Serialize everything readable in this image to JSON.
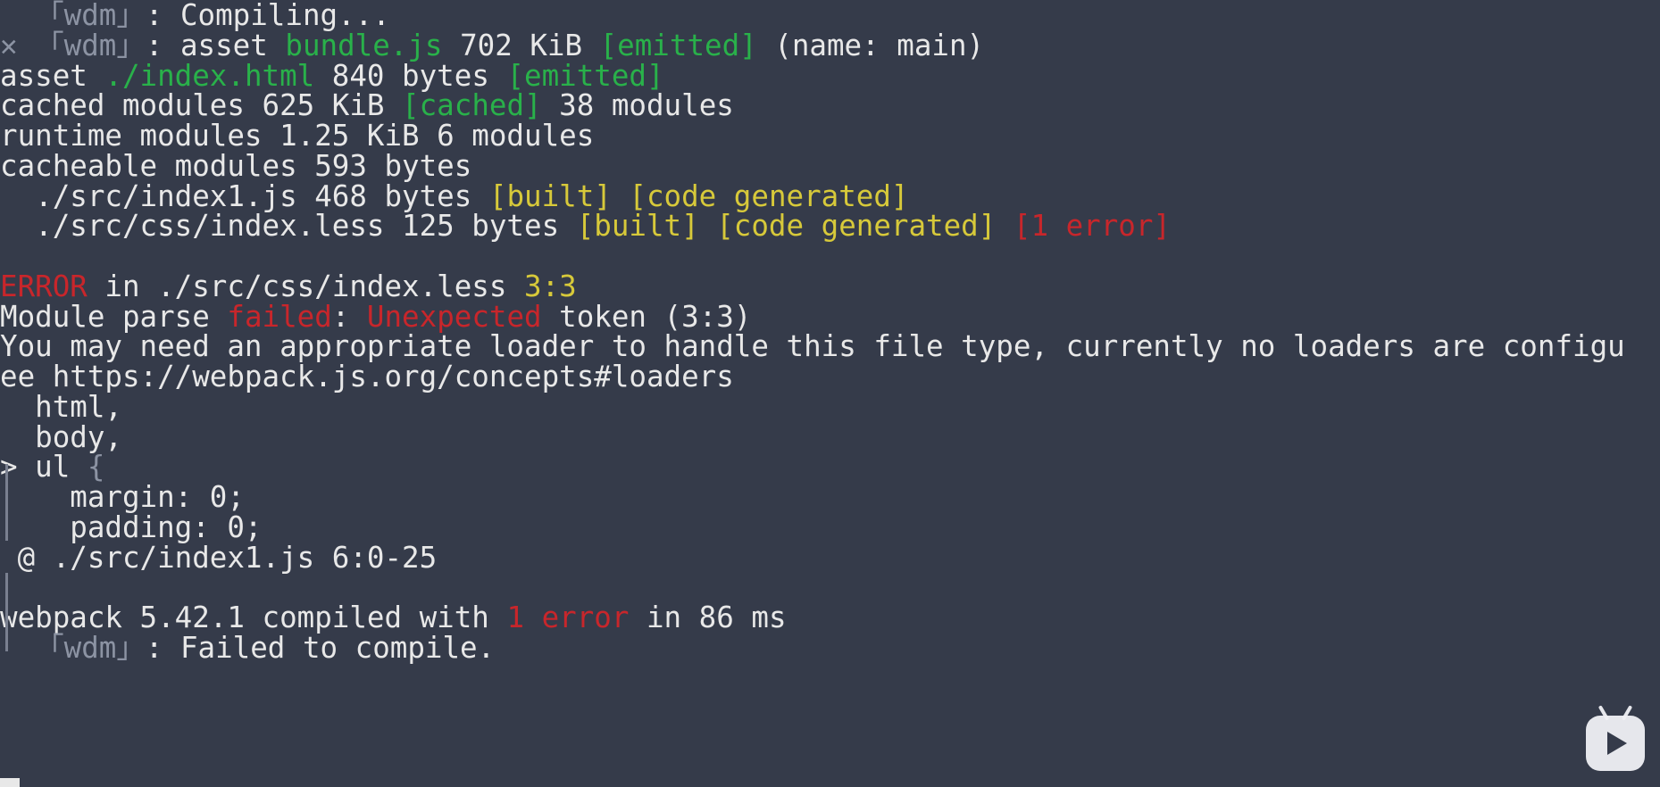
{
  "terminal": {
    "lines": [
      {
        "segments": [
          {
            "text": "  「wdm」",
            "color": "dim"
          },
          {
            "text": ": Compiling...",
            "color": "default"
          }
        ]
      },
      {
        "segments": [
          {
            "text": "✕ 「wdm」",
            "color": "dim"
          },
          {
            "text": ": asset ",
            "color": "default"
          },
          {
            "text": "bundle.js",
            "color": "green"
          },
          {
            "text": " 702 KiB ",
            "color": "default"
          },
          {
            "text": "[emitted]",
            "color": "green"
          },
          {
            "text": " (name: main)",
            "color": "default"
          }
        ]
      },
      {
        "segments": [
          {
            "text": "asset ",
            "color": "default"
          },
          {
            "text": "./index.html",
            "color": "green"
          },
          {
            "text": " 840 bytes ",
            "color": "default"
          },
          {
            "text": "[emitted]",
            "color": "green"
          }
        ]
      },
      {
        "segments": [
          {
            "text": "cached modules 625 KiB ",
            "color": "default"
          },
          {
            "text": "[cached]",
            "color": "green"
          },
          {
            "text": " 38 modules",
            "color": "default"
          }
        ]
      },
      {
        "segments": [
          {
            "text": "runtime modules 1.25 KiB 6 modules",
            "color": "default"
          }
        ]
      },
      {
        "segments": [
          {
            "text": "cacheable modules 593 bytes",
            "color": "default"
          }
        ]
      },
      {
        "segments": [
          {
            "text": "  ./src/index1.js 468 bytes ",
            "color": "default"
          },
          {
            "text": "[built] [code generated]",
            "color": "yellow"
          }
        ]
      },
      {
        "segments": [
          {
            "text": "  ./src/css/index.less 125 bytes ",
            "color": "default"
          },
          {
            "text": "[built] [code generated]",
            "color": "yellow"
          },
          {
            "text": " ",
            "color": "default"
          },
          {
            "text": "[1 error]",
            "color": "red"
          }
        ]
      },
      {
        "segments": [
          {
            "text": "",
            "color": "default"
          }
        ]
      },
      {
        "segments": [
          {
            "text": "ERROR",
            "color": "red"
          },
          {
            "text": " in ./src/css/index.less ",
            "color": "default"
          },
          {
            "text": "3:3",
            "color": "yellow"
          }
        ]
      },
      {
        "segments": [
          {
            "text": "Module parse ",
            "color": "default"
          },
          {
            "text": "failed",
            "color": "red"
          },
          {
            "text": ": ",
            "color": "default"
          },
          {
            "text": "Unexpected",
            "color": "red"
          },
          {
            "text": " token (3:3)",
            "color": "default"
          }
        ]
      },
      {
        "segments": [
          {
            "text": "You may need an appropriate loader to handle this file type, currently no loaders are configu",
            "color": "default"
          }
        ]
      },
      {
        "segments": [
          {
            "text": "ee https://webpack.js.org/concepts#loaders",
            "color": "default"
          }
        ]
      },
      {
        "segments": [
          {
            "text": "  html,",
            "color": "default"
          }
        ]
      },
      {
        "segments": [
          {
            "text": "  body,",
            "color": "default"
          }
        ]
      },
      {
        "segments": [
          {
            "text": "> ul ",
            "color": "default"
          },
          {
            "text": "{",
            "color": "dim"
          }
        ]
      },
      {
        "segments": [
          {
            "text": "    margin: 0;",
            "color": "default"
          }
        ]
      },
      {
        "segments": [
          {
            "text": "    padding: 0;",
            "color": "default"
          }
        ]
      },
      {
        "segments": [
          {
            "text": " @ ./src/index1.js 6:0-25",
            "color": "default"
          }
        ]
      },
      {
        "segments": [
          {
            "text": "",
            "color": "default"
          }
        ]
      },
      {
        "segments": [
          {
            "text": "webpack 5.42.1 compiled with ",
            "color": "default"
          },
          {
            "text": "1 error",
            "color": "red"
          },
          {
            "text": " in 86 ms",
            "color": "default"
          }
        ]
      },
      {
        "segments": [
          {
            "text": "  「wdm」",
            "color": "dim"
          },
          {
            "text": ": Failed to compile.",
            "color": "default"
          }
        ]
      }
    ]
  },
  "colors": {
    "background": "#353b4a",
    "default": "#e8e8e8",
    "dim": "#8c93a3",
    "green": "#29b14a",
    "yellow": "#d7c93a",
    "red": "#c8262b"
  },
  "overlay": {
    "icon": "bilibili-logo-icon"
  }
}
